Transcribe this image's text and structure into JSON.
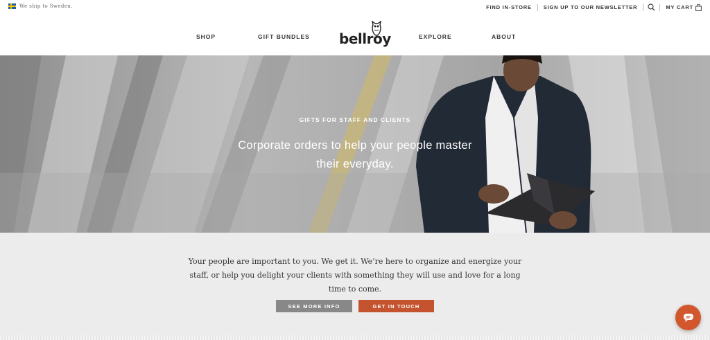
{
  "utility_bar": {
    "shipping_text": "We ship to Sweden.",
    "links": {
      "find_in_store": "FIND IN-STORE",
      "newsletter": "SIGN UP TO OUR NEWSLETTER",
      "cart": "MY CART"
    }
  },
  "nav": {
    "shop": "SHOP",
    "gift_bundles": "GIFT BUNDLES",
    "logo": "bellroy",
    "explore": "EXPLORE",
    "about": "ABOUT"
  },
  "hero": {
    "eyebrow": "GIFTS FOR STAFF AND CLIENTS",
    "headline": "Corporate orders to help your people master their everyday."
  },
  "intro": {
    "text": "Your people are important to you. We get it. We’re here to organize and energize your staff, or help you delight your clients with something they will use and love for a long time to come.",
    "see_more_label": "SEE MORE INFO",
    "get_in_touch_label": "GET IN TOUCH"
  },
  "colors": {
    "accent": "#c4542f",
    "secondary_button": "#888888",
    "section_bg": "#ececec"
  },
  "icons": {
    "flag": "sweden-flag-icon",
    "search": "search-icon",
    "cart": "shopping-bag-icon",
    "chat": "chat-icon",
    "logo_mark": "owl-icon"
  }
}
